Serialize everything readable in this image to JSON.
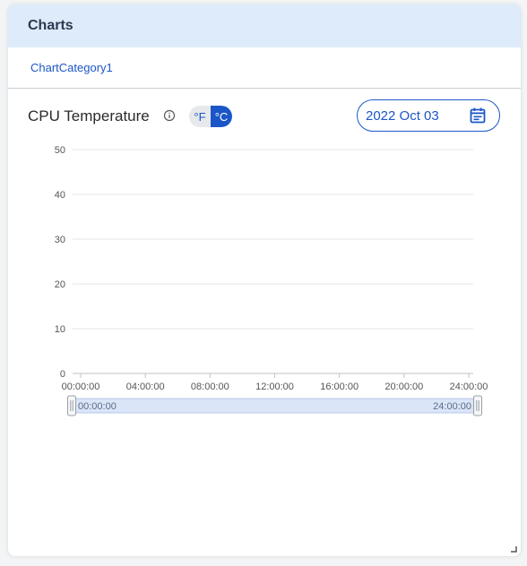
{
  "card": {
    "title": "Charts",
    "category": "ChartCategory1"
  },
  "chart_header": {
    "title": "CPU Temperature",
    "units": {
      "fahrenheit": "°F",
      "celsius": "°C",
      "selected": "celsius"
    },
    "date": "2022 Oct 03"
  },
  "colors": {
    "accent": "#1b56c8",
    "header_bg": "#deebfa",
    "grid": "#e2e4e8",
    "slider_fill": "#dbe5f8"
  },
  "icons": {
    "info": "info-icon",
    "calendar": "calendar-icon",
    "resize": "resize-handle-icon"
  },
  "chart_data": {
    "type": "line",
    "title": "CPU Temperature",
    "xlabel": "",
    "ylabel": "",
    "ylim": [
      0,
      50
    ],
    "y_ticks": [
      0,
      10,
      20,
      30,
      40,
      50
    ],
    "x_ticks": [
      "00:00:00",
      "04:00:00",
      "08:00:00",
      "12:00:00",
      "16:00:00",
      "20:00:00",
      "24:00:00"
    ],
    "grid": true,
    "series": [],
    "range_slider": {
      "start": "00:00:00",
      "end": "24:00:00",
      "start_fraction": 0,
      "end_fraction": 1
    }
  }
}
